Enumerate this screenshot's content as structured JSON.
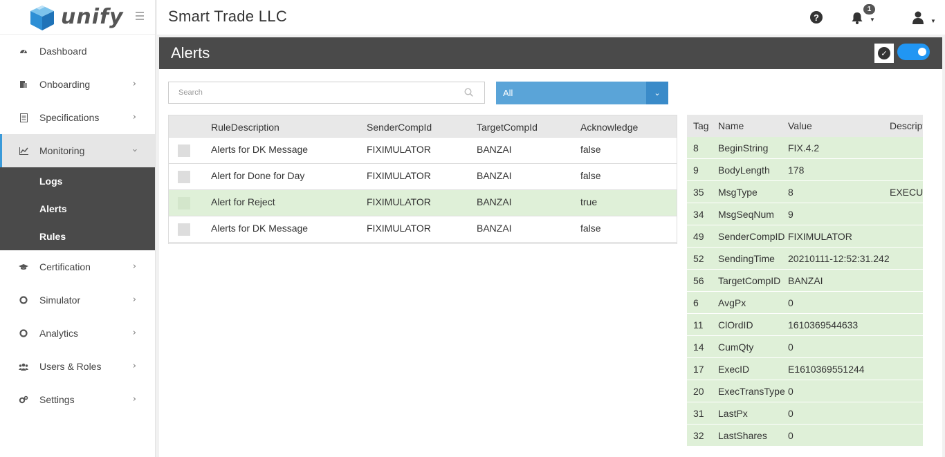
{
  "app": {
    "logo_text": "unify",
    "company": "Smart Trade LLC"
  },
  "sidebar": {
    "items": [
      {
        "label": "Dashboard",
        "icon": "dashboard-icon",
        "has_children": false
      },
      {
        "label": "Onboarding",
        "icon": "onboarding-icon",
        "has_children": true
      },
      {
        "label": "Specifications",
        "icon": "document-icon",
        "has_children": true
      },
      {
        "label": "Monitoring",
        "icon": "chart-icon",
        "has_children": true,
        "active": true
      },
      {
        "label": "Certification",
        "icon": "graduation-cap-icon",
        "has_children": true
      },
      {
        "label": "Simulator",
        "icon": "life-ring-icon",
        "has_children": true
      },
      {
        "label": "Analytics",
        "icon": "life-ring-icon",
        "has_children": true
      },
      {
        "label": "Users & Roles",
        "icon": "users-icon",
        "has_children": true
      },
      {
        "label": "Settings",
        "icon": "cogs-icon",
        "has_children": true
      }
    ],
    "submenu": [
      "Logs",
      "Alerts",
      "Rules"
    ]
  },
  "topbar": {
    "notification_count": "1"
  },
  "page": {
    "title": "Alerts",
    "toggle_on": true
  },
  "filters": {
    "search_placeholder": "Search",
    "select_value": "All"
  },
  "alerts_table": {
    "columns": [
      "RuleDescription",
      "SenderCompId",
      "TargetCompId",
      "Acknowledge"
    ],
    "rows": [
      {
        "rule": "Alerts for DK Message",
        "sender": "FIXIMULATOR",
        "target": "BANZAI",
        "ack": "false"
      },
      {
        "rule": "Alert for Done for Day",
        "sender": "FIXIMULATOR",
        "target": "BANZAI",
        "ack": "false"
      },
      {
        "rule": "Alert for Reject",
        "sender": "FIXIMULATOR",
        "target": "BANZAI",
        "ack": "true"
      },
      {
        "rule": "Alerts for DK Message",
        "sender": "FIXIMULATOR",
        "target": "BANZAI",
        "ack": "false"
      }
    ]
  },
  "detail_table": {
    "columns": [
      "Tag",
      "Name",
      "Value",
      "Descript"
    ],
    "rows": [
      {
        "tag": "8",
        "name": "BeginString",
        "value": "FIX.4.2",
        "desc": ""
      },
      {
        "tag": "9",
        "name": "BodyLength",
        "value": "178",
        "desc": ""
      },
      {
        "tag": "35",
        "name": "MsgType",
        "value": "8",
        "desc": "EXECUT"
      },
      {
        "tag": "34",
        "name": "MsgSeqNum",
        "value": "9",
        "desc": ""
      },
      {
        "tag": "49",
        "name": "SenderCompID",
        "value": "FIXIMULATOR",
        "desc": ""
      },
      {
        "tag": "52",
        "name": "SendingTime",
        "value": "20210111-12:52:31.242",
        "desc": ""
      },
      {
        "tag": "56",
        "name": "TargetCompID",
        "value": "BANZAI",
        "desc": ""
      },
      {
        "tag": "6",
        "name": "AvgPx",
        "value": "0",
        "desc": ""
      },
      {
        "tag": "11",
        "name": "ClOrdID",
        "value": "1610369544633",
        "desc": ""
      },
      {
        "tag": "14",
        "name": "CumQty",
        "value": "0",
        "desc": ""
      },
      {
        "tag": "17",
        "name": "ExecID",
        "value": "E1610369551244",
        "desc": ""
      },
      {
        "tag": "20",
        "name": "ExecTransType",
        "value": "0",
        "desc": ""
      },
      {
        "tag": "31",
        "name": "LastPx",
        "value": "0",
        "desc": ""
      },
      {
        "tag": "32",
        "name": "LastShares",
        "value": "0",
        "desc": ""
      }
    ]
  },
  "colors": {
    "accent": "#2196f3",
    "select_bg": "#5aa4d8",
    "ack_row": "#dff0d8",
    "header_bar": "#4a4a4a"
  }
}
